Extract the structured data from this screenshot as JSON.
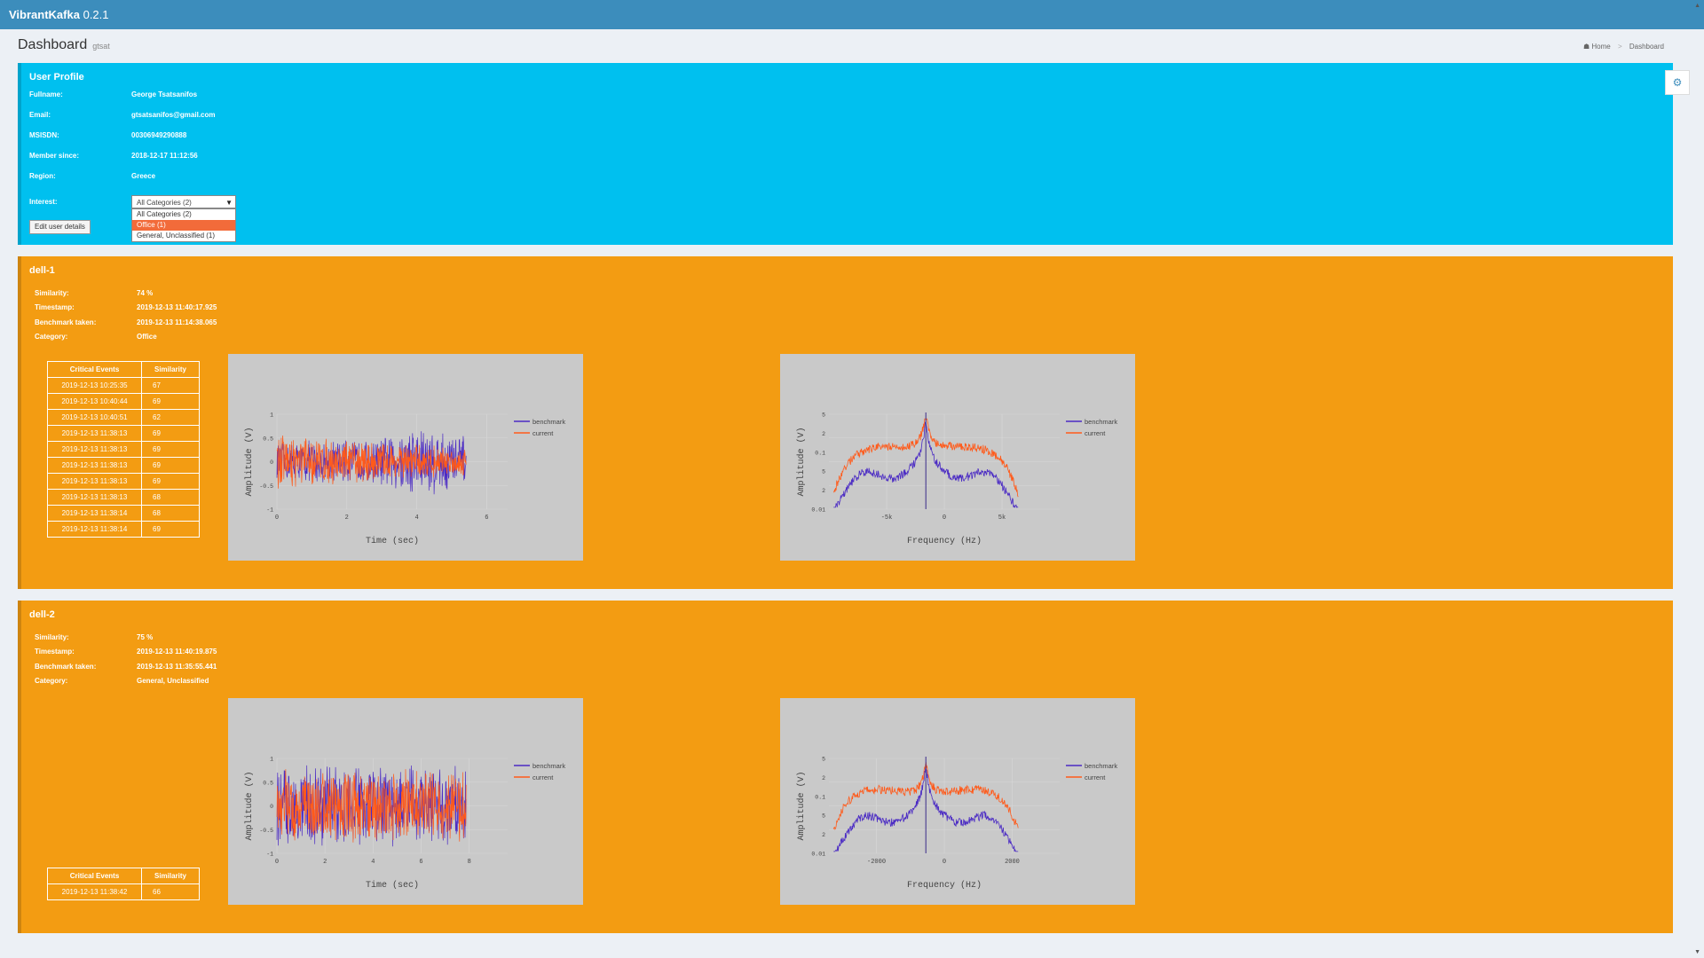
{
  "app": {
    "brand": "VibrantKafka",
    "version": "0.2.1"
  },
  "page": {
    "title": "Dashboard",
    "subtitle": "gtsat"
  },
  "breadcrumb": {
    "home": "Home",
    "current": "Dashboard"
  },
  "profile": {
    "title": "User Profile",
    "fields": [
      {
        "label": "Fullname:",
        "value": "George Tsatsanifos"
      },
      {
        "label": "Email:",
        "value": "gtsatsanifos@gmail.com"
      },
      {
        "label": "MSISDN:",
        "value": "00306949290888"
      },
      {
        "label": "Member since:",
        "value": "2018-12-17 11:12:56"
      },
      {
        "label": "Region:",
        "value": "Greece"
      }
    ],
    "interest_label": "Interest:",
    "interest_selected": "All Categories (2)",
    "interest_options": [
      "All Categories (2)",
      "Office (1)",
      "General, Unclassified (1)"
    ],
    "edit_label": "Edit user details"
  },
  "machines": [
    {
      "name": "dell-1",
      "fields": [
        {
          "label": "Similarity:",
          "value": "74 %"
        },
        {
          "label": "Timestamp:",
          "value": "2019-12-13 11:40:17.925"
        },
        {
          "label": "Benchmark taken:",
          "value": "2019-12-13 11:14:38.065"
        },
        {
          "label": "Category:",
          "value": "Office"
        }
      ],
      "table": {
        "headers": [
          "Critical Events",
          "Similarity"
        ],
        "rows": [
          [
            "2019-12-13 10:25:35",
            "67"
          ],
          [
            "2019-12-13 10:40:44",
            "69"
          ],
          [
            "2019-12-13 10:40:51",
            "62"
          ],
          [
            "2019-12-13 11:38:13",
            "69"
          ],
          [
            "2019-12-13 11:38:13",
            "69"
          ],
          [
            "2019-12-13 11:38:13",
            "69"
          ],
          [
            "2019-12-13 11:38:13",
            "69"
          ],
          [
            "2019-12-13 11:38:13",
            "68"
          ],
          [
            "2019-12-13 11:38:14",
            "68"
          ],
          [
            "2019-12-13 11:38:14",
            "69"
          ]
        ]
      }
    },
    {
      "name": "dell-2",
      "fields": [
        {
          "label": "Similarity:",
          "value": "75 %"
        },
        {
          "label": "Timestamp:",
          "value": "2019-12-13 11:40:19.875"
        },
        {
          "label": "Benchmark taken:",
          "value": "2019-12-13 11:35:55.441"
        },
        {
          "label": "Category:",
          "value": "General, Unclassified"
        }
      ],
      "table": {
        "headers": [
          "Critical Events",
          "Similarity"
        ],
        "rows": [
          [
            "2019-12-13 11:38:42",
            "66"
          ]
        ]
      }
    }
  ],
  "colors": {
    "header": "#3c8dbc",
    "profile_bg": "#00c0ef",
    "machine_bg": "#f39c12",
    "benchmark": "#4b2bc4",
    "current": "#ff5a1a",
    "chart_bg": "#c9c9c9"
  },
  "chart_data": [
    {
      "type": "line",
      "machine": "dell-1",
      "xlabel": "Time (sec)",
      "ylabel": "Amplitude (V)",
      "xlim": [
        0,
        6.6
      ],
      "ylim": [
        -1,
        1
      ],
      "xticks": [
        "0",
        "2",
        "4",
        "6"
      ],
      "yticks": [
        "1",
        "0.5",
        "0",
        "-0.5",
        "-1"
      ],
      "legend": [
        "benchmark",
        "current"
      ],
      "series": [
        {
          "name": "benchmark",
          "envelope": [
            [
              0,
              0.45
            ],
            [
              3.5,
              0.5
            ],
            [
              4.8,
              0.85
            ],
            [
              6.6,
              0.6
            ]
          ]
        },
        {
          "name": "current",
          "envelope": [
            [
              0,
              0.6
            ],
            [
              3.5,
              0.45
            ],
            [
              6.6,
              0.3
            ]
          ]
        }
      ]
    },
    {
      "type": "line",
      "machine": "dell-1",
      "xlabel": "Frequency (Hz)",
      "ylabel": "Amplitude (V)",
      "xlim": [
        -10000,
        10000
      ],
      "log_y": true,
      "xticks": [
        "-5k",
        "0",
        "5k"
      ],
      "yticks": [
        "5",
        "2",
        "0.1",
        "5",
        "2",
        "0.01"
      ],
      "legend": [
        "benchmark",
        "current"
      ]
    },
    {
      "type": "line",
      "machine": "dell-2",
      "xlabel": "Time (sec)",
      "ylabel": "Amplitude (V)",
      "xlim": [
        0,
        9.6
      ],
      "ylim": [
        -1,
        1
      ],
      "xticks": [
        "0",
        "2",
        "4",
        "6",
        "8"
      ],
      "yticks": [
        "1",
        "0.5",
        "0",
        "-0.5",
        "-1"
      ],
      "legend": [
        "benchmark",
        "current"
      ],
      "series": [
        {
          "name": "benchmark",
          "envelope": [
            [
              0,
              0.9
            ],
            [
              9.6,
              0.9
            ]
          ]
        },
        {
          "name": "current",
          "envelope": [
            [
              0,
              0.8
            ],
            [
              9.6,
              0.8
            ]
          ]
        }
      ]
    },
    {
      "type": "line",
      "machine": "dell-2",
      "xlabel": "Frequency (Hz)",
      "ylabel": "Amplitude (V)",
      "xlim": [
        -3400,
        3400
      ],
      "log_y": true,
      "xticks": [
        "-2000",
        "0",
        "2000"
      ],
      "yticks": [
        "5",
        "2",
        "0.1",
        "5",
        "2",
        "0.01"
      ],
      "legend": [
        "benchmark",
        "current"
      ]
    }
  ]
}
